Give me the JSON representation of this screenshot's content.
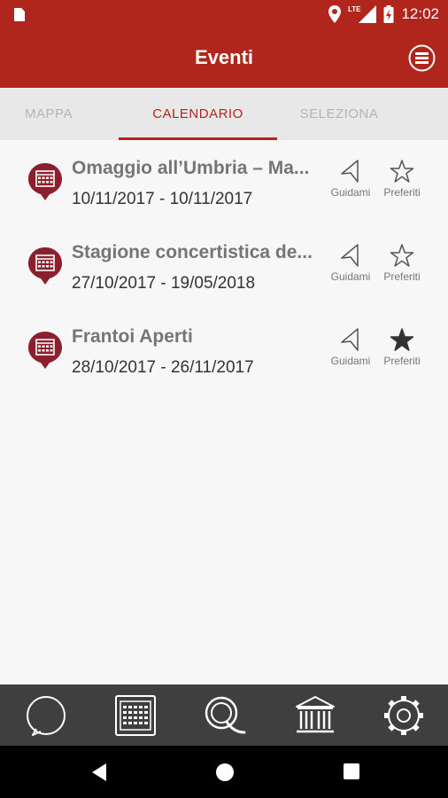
{
  "status_bar": {
    "time": "12:02",
    "network_label": "LTE",
    "icons": [
      "sim-card-icon",
      "location-icon",
      "signal-icon",
      "battery-icon"
    ]
  },
  "app_bar": {
    "title": "Eventi",
    "menu_icon": "menu-icon"
  },
  "tabs": [
    {
      "label": "MAPPA",
      "active": false
    },
    {
      "label": "CALENDARIO",
      "active": true
    },
    {
      "label": "SELEZIONA",
      "active": false
    }
  ],
  "events": [
    {
      "title": "Omaggio all’Umbria – Ma...",
      "dates": "10/11/2017 - 10/11/2017",
      "guide_label": "Guidami",
      "favorite_label": "Preferiti",
      "favorite": false
    },
    {
      "title": "Stagione concertistica de...",
      "dates": "27/10/2017 - 19/05/2018",
      "guide_label": "Guidami",
      "favorite_label": "Preferiti",
      "favorite": false
    },
    {
      "title": "Frantoi Aperti",
      "dates": "28/10/2017 - 26/11/2017",
      "guide_label": "Guidami",
      "favorite_label": "Preferiti",
      "favorite": true
    }
  ],
  "bottom_nav": [
    {
      "icon": "circle-icon"
    },
    {
      "icon": "calendar-icon"
    },
    {
      "icon": "search-q-icon"
    },
    {
      "icon": "museum-icon"
    },
    {
      "icon": "gear-icon"
    }
  ],
  "system_nav": [
    "back-icon",
    "home-icon",
    "recents-icon"
  ],
  "colors": {
    "primary": "#b0261c",
    "pin": "#8b1f2d",
    "tab_bar": "#e8e8e8",
    "bottom_bar": "#3f3f3f"
  }
}
